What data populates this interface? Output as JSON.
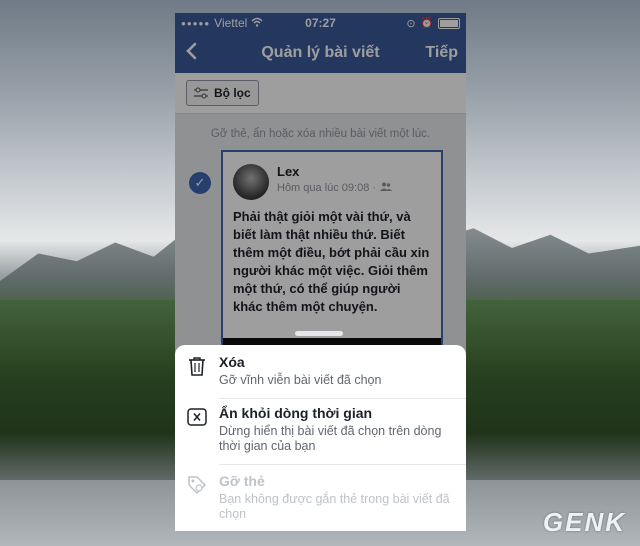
{
  "status_bar": {
    "carrier": "Viettel",
    "time": "07:27"
  },
  "nav": {
    "back_icon": "chevron-left-icon",
    "title": "Quản lý bài viết",
    "next_label": "Tiếp"
  },
  "filter": {
    "label": "Bộ lọc"
  },
  "hint": "Gỡ thẻ, ẩn hoặc xóa nhiều bài viết một lúc.",
  "post": {
    "author": "Lex",
    "timestamp": "Hôm qua lúc 09:08 ·",
    "text": "Phải thật giỏi một vài thứ, và biết làm thật nhiều thứ. Biết thêm một điều, bớt phải cầu xin người khác một việc. Giỏi thêm một thứ, có thể giúp người khác thêm một chuyện.",
    "selected": true
  },
  "actions": [
    {
      "icon": "trash-icon",
      "title": "Xóa",
      "description": "Gỡ vĩnh viễn bài viết đã chọn",
      "enabled": true
    },
    {
      "icon": "close-box-icon",
      "title": "Ẩn khỏi dòng thời gian",
      "description": "Dừng hiển thị bài viết đã chọn trên dòng thời gian của bạn",
      "enabled": true
    },
    {
      "icon": "tag-icon",
      "title": "Gỡ thẻ",
      "description": "Bạn không được gắn thẻ trong bài viết đã chọn",
      "enabled": false
    }
  ],
  "watermark": "GENK",
  "colors": {
    "facebook_blue": "#3b5998",
    "select_blue": "#4267b2"
  }
}
